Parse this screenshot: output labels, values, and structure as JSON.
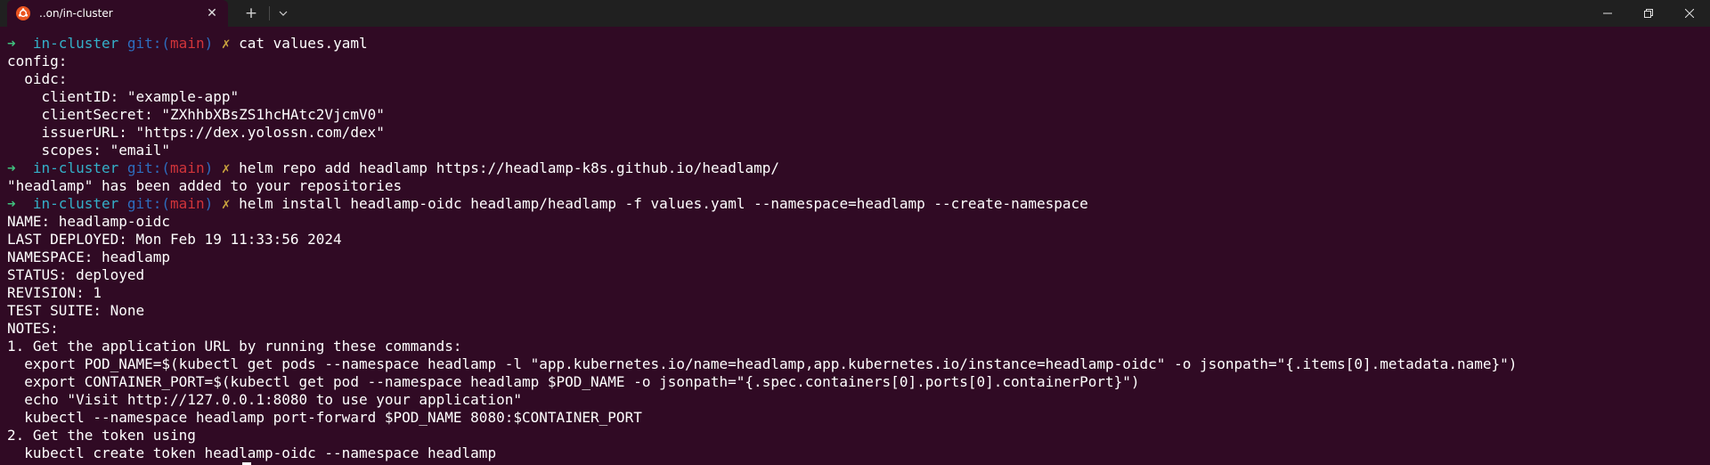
{
  "tab": {
    "title": "..on/in-cluster",
    "close_icon": "✕",
    "new_tab_icon": "+",
    "dropdown_icon": "⌄"
  },
  "window_controls": {
    "minimize_icon": "minimize-icon",
    "maximize_icon": "maximize-icon",
    "close_icon": "close-icon"
  },
  "colors": {
    "background": "#300a24",
    "prompt_arrow": "#3fc17e",
    "prompt_dir": "#34b0c9",
    "prompt_git": "#2d6dbe",
    "prompt_branch": "#d1343a",
    "prompt_dirty": "#c8a23d"
  },
  "prompt": {
    "arrow": "➜",
    "dir": "in-cluster",
    "git_open": "git:(",
    "branch": "main",
    "git_close": ")",
    "dirty": "✗"
  },
  "commands": [
    "cat values.yaml",
    "helm repo add headlamp https://headlamp-k8s.github.io/headlamp/",
    "helm install headlamp-oidc headlamp/headlamp -f values.yaml --namespace=headlamp --create-namespace"
  ],
  "output": {
    "values_yaml": [
      "config:",
      "  oidc:",
      "    clientID: \"example-app\"",
      "    clientSecret: \"ZXhhbXBsZS1hcHAtc2VjcmV0\"",
      "    issuerURL: \"https://dex.yolossn.com/dex\"",
      "    scopes: \"email\""
    ],
    "repo_add": [
      "\"headlamp\" has been added to your repositories"
    ],
    "install": [
      "NAME: headlamp-oidc",
      "LAST DEPLOYED: Mon Feb 19 11:33:56 2024",
      "NAMESPACE: headlamp",
      "STATUS: deployed",
      "REVISION: 1",
      "TEST SUITE: None",
      "NOTES:",
      "1. Get the application URL by running these commands:",
      "  export POD_NAME=$(kubectl get pods --namespace headlamp -l \"app.kubernetes.io/name=headlamp,app.kubernetes.io/instance=headlamp-oidc\" -o jsonpath=\"{.items[0].metadata.name}\")",
      "  export CONTAINER_PORT=$(kubectl get pod --namespace headlamp $POD_NAME -o jsonpath=\"{.spec.containers[0].ports[0].containerPort}\")",
      "  echo \"Visit http://127.0.0.1:8080 to use your application\"",
      "  kubectl --namespace headlamp port-forward $POD_NAME 8080:$CONTAINER_PORT",
      "2. Get the token using",
      "  kubectl create token headlamp-oidc --namespace headlamp"
    ]
  }
}
